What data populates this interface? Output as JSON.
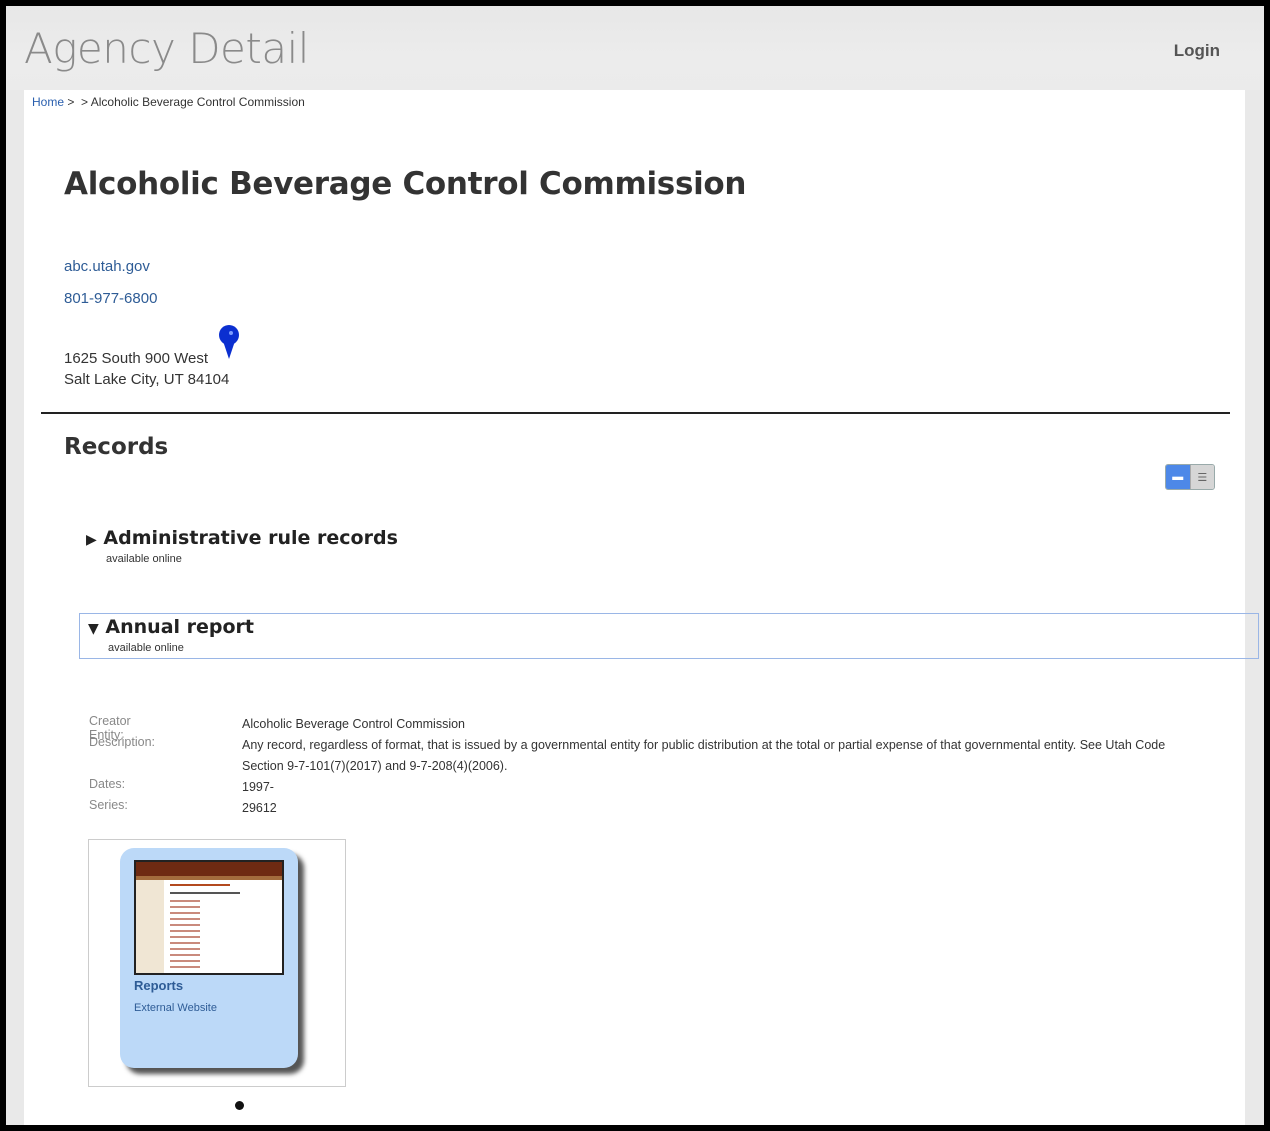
{
  "header": {
    "title": "Agency Detail",
    "login_label": "Login"
  },
  "breadcrumb": {
    "home": "Home",
    "sep": ">",
    "current": "> Alcoholic Beverage Control Commission"
  },
  "agency": {
    "name": "Alcoholic Beverage Control Commission",
    "website": "abc.utah.gov",
    "phone": "801-977-6800",
    "address_line1": "1625 South 900 West",
    "address_line2": "Salt Lake City, UT 84104"
  },
  "records": {
    "title": "Records",
    "items": [
      {
        "label": "Administrative rule records",
        "note": "available online",
        "expanded": false
      },
      {
        "label": "Annual report",
        "note": "available online",
        "expanded": true
      }
    ],
    "detail": {
      "creator_label": "Creator Entity:",
      "creator_value": "Alcoholic Beverage Control Commission",
      "description_label": "Description:",
      "description_value": "Any record, regardless of format, that is issued by a governmental entity for public distribution at the total or partial expense of that governmental entity. See Utah Code Section 9-7-101(7)(2017) and 9-7-208(4)(2006).",
      "dates_label": "Dates:",
      "dates_value": "1997-",
      "series_label": "Series:",
      "series_value": "29612"
    },
    "card": {
      "title": "Reports",
      "subtitle": "External Website"
    }
  },
  "colors": {
    "link": "#2e5c96",
    "card_bg": "#bcd9f8",
    "toggle_active": "#4d88e8"
  },
  "icons": {
    "pin": "map-pin-icon",
    "collapsed": "triangle-right-icon",
    "expanded": "triangle-down-icon"
  }
}
